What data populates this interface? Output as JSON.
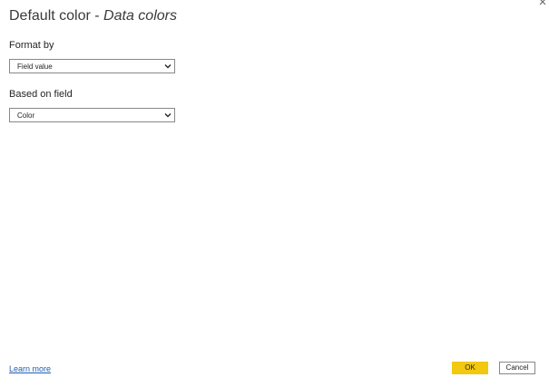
{
  "dialog": {
    "title": "Default color",
    "separator": " - ",
    "subtitle": "Data colors",
    "close_icon": "close-icon"
  },
  "format_by": {
    "label": "Format by",
    "selected": "Field value"
  },
  "based_on_field": {
    "label": "Based on field",
    "selected": "Color"
  },
  "footer": {
    "learn_more": "Learn more",
    "ok_label": "OK",
    "cancel_label": "Cancel"
  },
  "colors": {
    "accent": "#f2c811",
    "link": "#1f5fb0"
  }
}
